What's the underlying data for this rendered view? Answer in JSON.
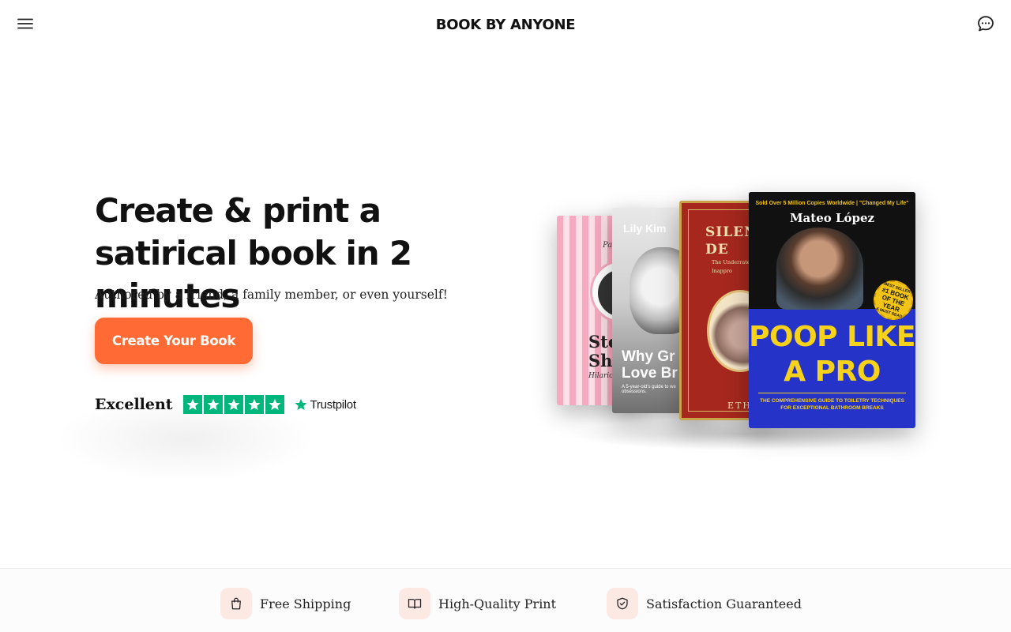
{
  "header": {
    "brand": "BOOK BY ANYONE",
    "menu_icon": "hamburger-menu-icon",
    "chat_icon": "chat-bubble-icon"
  },
  "hero": {
    "headline": "Create & print a satirical book in 2 minutes",
    "subline": "Authored by a friend, a family member, or even yourself!",
    "cta_label": "Create Your Book",
    "rating": {
      "label": "Excellent",
      "stars": 5,
      "provider": "Trustpilot"
    }
  },
  "books": {
    "book_1": {
      "top_text": "Pa",
      "title_line_1": "Steth",
      "title_line_2": "Shen",
      "subtitle": "Hilarious Tale"
    },
    "book_2": {
      "author": "Lily Kim",
      "title_line_1": "Why Gr",
      "title_line_2": "Love Br",
      "blurb": "A 5-year-old's guide to we obsessions."
    },
    "book_3": {
      "title_line_1": "SILEN",
      "title_line_2": "DE",
      "subtitle_line_1": "The Underrate",
      "subtitle_line_2": "Inappro",
      "author": "ETH"
    },
    "book_4": {
      "tagline": "Sold Over 5 Million Copies Worldwide | \"Changed My Life\"",
      "author": "Mateo López",
      "badge_top": "BEST SELLER",
      "badge_main": "#1 BOOK OF THE YEAR",
      "badge_bottom": "A MUST READ",
      "title_line_1": "POOP LIKE",
      "title_line_2": "A PRO",
      "strapline": "THE COMPREHENSIVE GUIDE TO TOILETRY TECHNIQUES FOR EXCEPTIONAL BATHROOM BREAKS"
    }
  },
  "features": [
    {
      "label": "Free Shipping",
      "icon": "shopping-bag-icon"
    },
    {
      "label": "High-Quality Print",
      "icon": "open-book-icon"
    },
    {
      "label": "Satisfaction Guaranteed",
      "icon": "shield-check-icon"
    }
  ],
  "colors": {
    "accent": "#ff6a35",
    "trustpilot_green": "#00b67a",
    "feature_icon_bg": "#fde9e4"
  }
}
